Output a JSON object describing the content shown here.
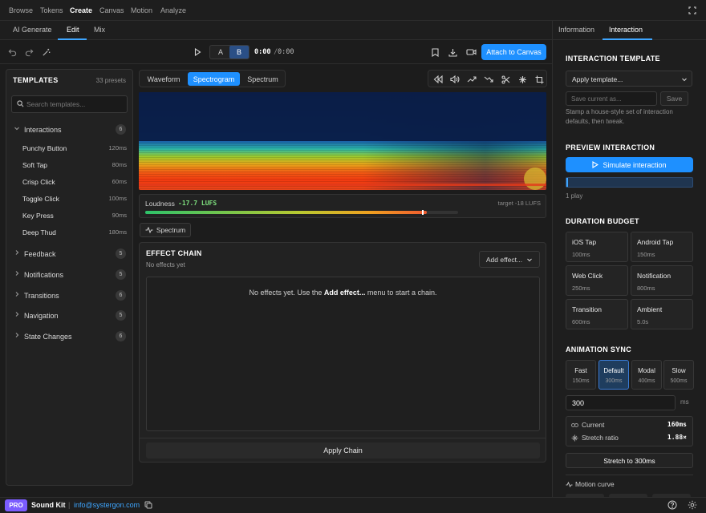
{
  "topnav": {
    "items": [
      "Browse",
      "Tokens",
      "Create",
      "Canvas",
      "Motion",
      "Analyze"
    ],
    "active": "Create"
  },
  "subtabs": {
    "items": [
      "AI Generate",
      "Edit",
      "Mix"
    ],
    "active": "Edit"
  },
  "righttabs": {
    "items": [
      "Information",
      "Interaction"
    ],
    "active": "Interaction"
  },
  "toolbar": {
    "a_label": "A",
    "b_label": "B",
    "time_current": "0:00",
    "time_sep": " / ",
    "time_total": "0:00",
    "attach_label": "Attach to Canvas"
  },
  "templates": {
    "title": "TEMPLATES",
    "preset_count": "33 presets",
    "search_placeholder": "Search templates...",
    "categories": [
      {
        "label": "Interactions",
        "count": "6",
        "expanded": true
      },
      {
        "label": "Feedback",
        "count": "5"
      },
      {
        "label": "Notifications",
        "count": "5"
      },
      {
        "label": "Transitions",
        "count": "6"
      },
      {
        "label": "Navigation",
        "count": "5"
      },
      {
        "label": "State Changes",
        "count": "6"
      }
    ],
    "items": [
      {
        "name": "Punchy Button",
        "dur": "120ms"
      },
      {
        "name": "Soft Tap",
        "dur": "80ms"
      },
      {
        "name": "Crisp Click",
        "dur": "60ms"
      },
      {
        "name": "Toggle Click",
        "dur": "100ms"
      },
      {
        "name": "Key Press",
        "dur": "90ms"
      },
      {
        "name": "Deep Thud",
        "dur": "180ms"
      }
    ]
  },
  "viewmodes": {
    "items": [
      "Waveform",
      "Spectrogram",
      "Spectrum"
    ],
    "active": "Spectrogram"
  },
  "loudness": {
    "label": "Loudness",
    "value": "-17.7 LUFS",
    "target": "target -18 LUFS",
    "fill_fraction": 0.9
  },
  "spectrum_toggle": "Spectrum",
  "effect_chain": {
    "title": "EFFECT CHAIN",
    "subtitle": "No effects yet",
    "add_label": "Add effect...",
    "empty_pre": "No effects yet. Use the ",
    "empty_bold": "Add effect...",
    "empty_post": " menu to start a chain.",
    "apply_label": "Apply Chain"
  },
  "interaction": {
    "template_title": "INTERACTION TEMPLATE",
    "apply_select": "Apply template...",
    "save_placeholder": "Save current as...",
    "save_label": "Save",
    "help": "Stamp a house-style set of interaction defaults, then tweak.",
    "preview_title": "PREVIEW INTERACTION",
    "simulate_label": "Simulate interaction",
    "plays": "1 play",
    "budget_title": "DURATION BUDGET",
    "budget": [
      {
        "t": "iOS Tap",
        "s": "100ms"
      },
      {
        "t": "Android Tap",
        "s": "150ms"
      },
      {
        "t": "Web Click",
        "s": "250ms"
      },
      {
        "t": "Notification",
        "s": "800ms"
      },
      {
        "t": "Transition",
        "s": "600ms"
      },
      {
        "t": "Ambient",
        "s": "5.0s"
      }
    ],
    "sync_title": "ANIMATION SYNC",
    "sync": [
      {
        "t": "Fast",
        "s": "150ms"
      },
      {
        "t": "Default",
        "s": "300ms",
        "active": true
      },
      {
        "t": "Modal",
        "s": "400ms"
      },
      {
        "t": "Slow",
        "s": "500ms"
      }
    ],
    "ms_value": "300",
    "ms_unit": "ms",
    "current_label": "Current",
    "current_value": "160ms",
    "stretch_label": "Stretch ratio",
    "stretch_value": "1.88×",
    "stretch_button": "Stretch to 300ms",
    "motion_curve": "Motion curve"
  },
  "footer": {
    "badge": "PRO",
    "product": "Sound Kit",
    "sep": "|",
    "email": "info@systergon.com"
  },
  "colors": {
    "accent": "#1e90ff",
    "badge": "#7b5cff"
  }
}
